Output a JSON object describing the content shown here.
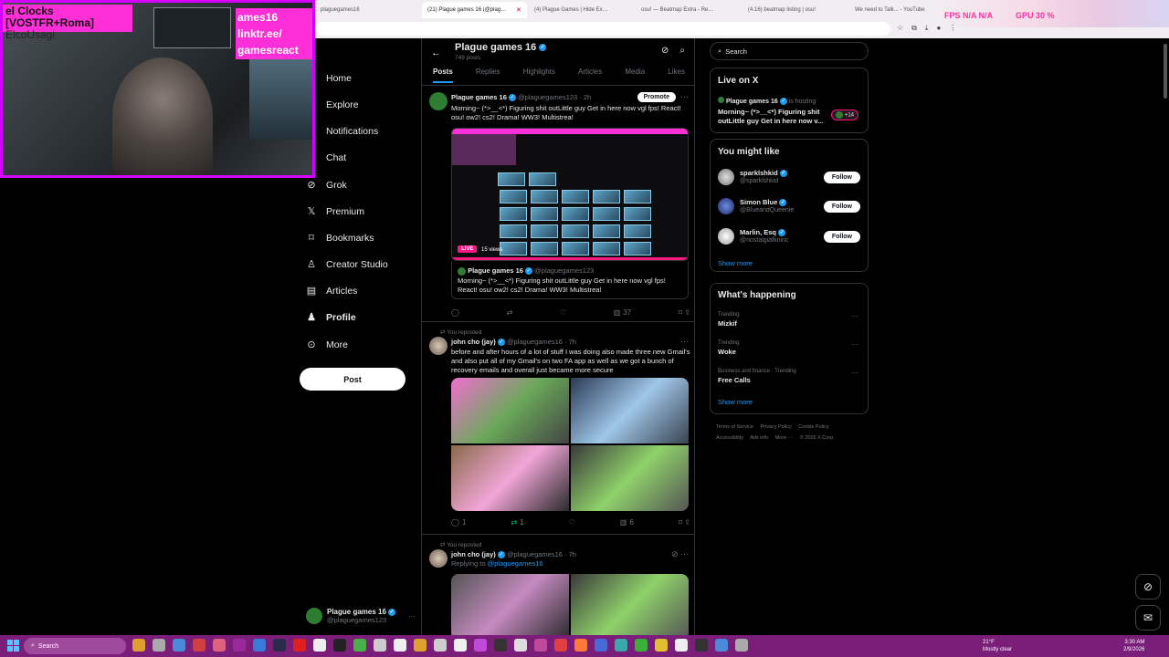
{
  "browser": {
    "tabs": [
      {
        "label": "plaguegames16",
        "active": false
      },
      {
        "label": "(21) Plague games 16 (@plag…",
        "active": true
      },
      {
        "label": "(4) Plague Games | Hide Ex…",
        "active": false
      },
      {
        "label": "osu! — Beatmap Extra - Re…",
        "active": false
      },
      {
        "label": "(4.16) beatmap listing | osu!",
        "active": false
      },
      {
        "label": "We need to Talk... - YouTube",
        "active": false
      }
    ],
    "overlay_fps": "FPS N/A N/A",
    "overlay_gpu": "GPU 30 %"
  },
  "webcam": {
    "title_line1": "el Clocks [VOSTFR+Roma]",
    "title_line2": "ElcoUsagi",
    "link_line1": "ames16 linktr.ee/",
    "link_line2": "gamesreact"
  },
  "nav": {
    "items": [
      {
        "label": "Home",
        "icon": "home-icon"
      },
      {
        "label": "Explore",
        "icon": "search-icon"
      },
      {
        "label": "Notifications",
        "icon": "bell-icon"
      },
      {
        "label": "Chat",
        "icon": "chat-icon"
      },
      {
        "label": "Grok",
        "icon": "grok-icon"
      },
      {
        "label": "Premium",
        "icon": "x-logo-icon"
      },
      {
        "label": "Bookmarks",
        "icon": "bookmark-icon"
      },
      {
        "label": "Creator Studio",
        "icon": "creator-icon"
      },
      {
        "label": "Articles",
        "icon": "articles-icon"
      },
      {
        "label": "Profile",
        "icon": "person-icon"
      },
      {
        "label": "More",
        "icon": "more-circle-icon"
      }
    ],
    "post_label": "Post",
    "account_name": "Plague games 16",
    "account_handle": "@plaguegames123"
  },
  "profile": {
    "name": "Plague games 16",
    "posts_count": "749 posts",
    "tabs": [
      "Posts",
      "Replies",
      "Highlights",
      "Articles",
      "Media",
      "Likes"
    ]
  },
  "tweets": [
    {
      "name": "Plague games 16",
      "handle": "@plaguegames123 · 2h",
      "promote": "Promote",
      "text": "Morning~ (*>__<*) Figuring shit outLittle guy Get in here now vgl fps! React! osu! ow2! cs2! Drama! WW3! Multistrea!",
      "live": "LIVE",
      "views": "15 views",
      "quote_name": "Plague games 16",
      "quote_handle": "@plaguegames123",
      "quote_text": "Morning~ (*>__<*) Figuring shit outLittle guy Get in here now vgl fps! React! osu! ow2! cs2! Drama! WW3! Multistrea!",
      "stats": {
        "replies": "",
        "reposts": "",
        "likes": "",
        "views": "37"
      }
    },
    {
      "repost_note": "You reposted",
      "name": "john cho (jay)",
      "handle": "@plaguegames16 · 7h",
      "text": "before and after hours of a lot of stuff I was doing  also made three new Gmail's and also put all of my Gmail's on two FA app as well as we got a bunch of recovery emails and overall just became more secure",
      "stats": {
        "replies": "1",
        "reposts": "1",
        "likes": "",
        "views": "6"
      }
    },
    {
      "repost_note": "You reposted",
      "name": "john cho (jay)",
      "handle": "@plaguegames16 · 7h",
      "replying_prefix": "Replying to",
      "replying_to": "@plaguegames16"
    }
  ],
  "right": {
    "search_placeholder": "Search",
    "live": {
      "title": "Live on X",
      "host": "Plague games 16",
      "host_suffix": "is hosting",
      "text": "Morning~ (*>__<*) Figuring shit outLittle guy Get in here now v...",
      "count": "+14"
    },
    "might_like": {
      "title": "You might like",
      "people": [
        {
          "name": "sparklshkid",
          "handle": "@sparklshkid",
          "follow": "Follow"
        },
        {
          "name": "Simon Blue",
          "handle": "@BlueandQueenie",
          "follow": "Follow"
        },
        {
          "name": "Marlin, Esq",
          "handle": "@nostalgiafkninc",
          "follow": "Follow"
        }
      ],
      "show_more": "Show more"
    },
    "happening": {
      "title": "What's happening",
      "trends": [
        {
          "meta": "Trending",
          "name": "Mizkif"
        },
        {
          "meta": "Trending",
          "name": "Woke"
        },
        {
          "meta": "Business and finance · Trending",
          "name": "Free Calls"
        }
      ],
      "show_more": "Show more"
    },
    "footer": [
      "Terms of Service",
      "Privacy Policy",
      "Cookie Policy",
      "Accessibility",
      "Ads info",
      "More ···",
      "© 2026 X Corp."
    ]
  },
  "taskbar": {
    "search": "Search",
    "weather_temp": "21°F",
    "weather_text": "Mostly clear",
    "time": "3:30 AM",
    "date": "2/9/2026"
  },
  "colors": {
    "accent": "#1d9bf0",
    "webcam_border": "#d400ff",
    "taskbar": "#7a1e7a",
    "live_pink": "#f91880"
  }
}
